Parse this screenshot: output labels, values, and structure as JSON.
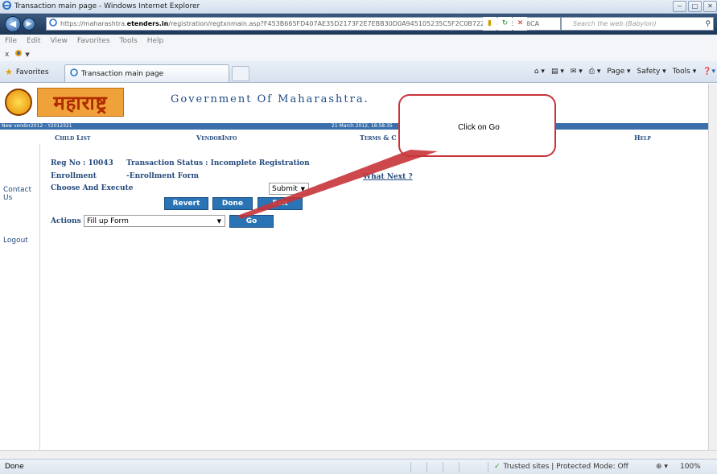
{
  "window": {
    "title": "Transaction main page - Windows Internet Explorer",
    "controls": [
      "−",
      "□",
      "✕"
    ]
  },
  "address_bar": {
    "url_prefix": "https://maharashtra.",
    "url_domain": "etenders.in",
    "url_rest": "/registration/regtxnmain.asp?F453B665FD407AE35D2173F2E7EBB30D0A945105235C5F2C0B7227A61E1EDF76CA",
    "search_placeholder": "Search the web (Babylon)"
  },
  "menubar": {
    "items": [
      "File",
      "Edit",
      "View",
      "Favorites",
      "Tools",
      "Help"
    ]
  },
  "command_row": {
    "close_x": "x"
  },
  "favorites_bar": {
    "favorites_label": "Favorites",
    "tab_title": "Transaction main page",
    "commands": [
      "Page ▾",
      "Safety ▾",
      "Tools ▾"
    ]
  },
  "page": {
    "logo_text": "महाराष्ट्र",
    "gov_title": "Government Of Maharashtra.",
    "bluebar_left": "New vendor2012 - Y2012321",
    "bluebar_date": "21 March 2012, 18:58:35",
    "nav": {
      "child_list": "Child List",
      "vendor_info": "VendorInfo",
      "terms": "Terms & C",
      "help": "Help"
    },
    "sidenav": {
      "contact": "Contact Us",
      "logout": "Logout"
    },
    "reg_no": "Reg No : 10043",
    "txn_status": "Transaction Status : Incomplete Registration",
    "enrollment": "Enrollment",
    "enrollment_form": "-Enrollment Form",
    "whats_next": "What Next ?",
    "choose_execute": "Choose And Execute",
    "submit_select": "Submit",
    "buttons": {
      "revert": "Revert",
      "done": "Done",
      "exit": "Exit",
      "go": "Go"
    },
    "actions_label": "Actions :",
    "actions_select": "Fill up Form"
  },
  "callout": {
    "text": "Click on Go"
  },
  "statusbar": {
    "status": "Done",
    "zone": "Trusted sites | Protected Mode: Off",
    "zoom": "100%"
  },
  "colors": {
    "primary_blue": "#2a74b5",
    "nav_text": "#244a7c",
    "callout_red": "#c8343a",
    "logo_orange": "#f0a23a"
  }
}
